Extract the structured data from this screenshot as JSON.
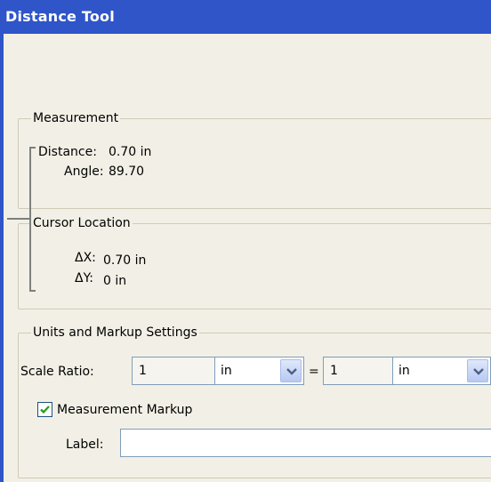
{
  "window": {
    "title": "Distance Tool"
  },
  "measurement": {
    "legend": "Measurement",
    "distance_label": "Distance:",
    "distance_value": "0.70 in",
    "angle_label": "Angle:",
    "angle_value": "89.70"
  },
  "cursor": {
    "legend": "Cursor Location",
    "dx_label": "ΔX:",
    "dx_value": "0.70 in",
    "dy_label": "ΔY:",
    "dy_value": "0 in"
  },
  "settings": {
    "legend": "Units and Markup Settings",
    "scale_label": "Scale Ratio:",
    "scale_left_value": "1",
    "scale_left_unit": "in",
    "equals": "=",
    "scale_right_value": "1",
    "scale_right_unit": "in",
    "markup_label": "Measurement Markup",
    "markup_checked": true,
    "label_label": "Label:",
    "label_value": ""
  },
  "colors": {
    "titlebar": "#2f55c9",
    "panel": "#f2f0e6",
    "check": "#21a121"
  },
  "icons": {
    "dropdown": "chevron-down-icon",
    "checkbox": "checkmark-icon"
  }
}
